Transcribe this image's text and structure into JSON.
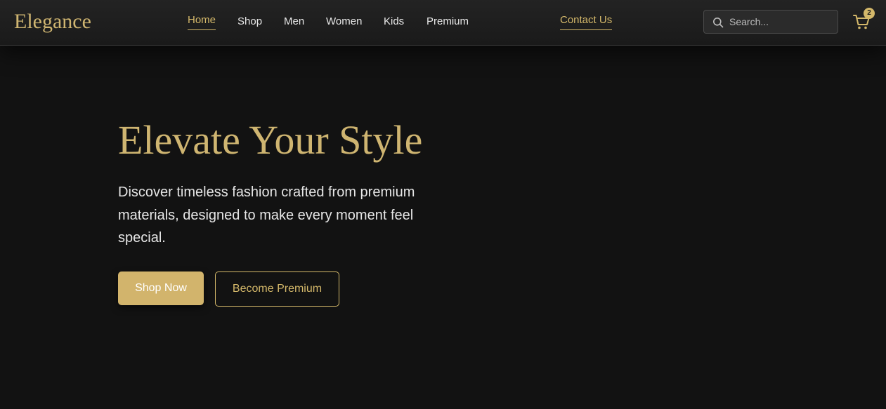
{
  "brand": {
    "logo_text": "Elegance",
    "accent_color": "#d4b86a",
    "background_color": "#121212"
  },
  "nav": {
    "items": [
      {
        "label": "Home",
        "active": true
      },
      {
        "label": "Shop",
        "active": false
      },
      {
        "label": "Men",
        "active": false
      },
      {
        "label": "Women",
        "active": false
      },
      {
        "label": "Kids",
        "active": false
      },
      {
        "label": "Premium",
        "active": false
      }
    ],
    "contact_label": "Contact Us"
  },
  "search": {
    "placeholder": "Search...",
    "value": "",
    "icon": "search-icon"
  },
  "cart": {
    "icon": "cart-icon",
    "count": "2"
  },
  "hero": {
    "title": "Elevate Your Style",
    "description": "Discover timeless fashion crafted from premium materials, designed to make every moment feel special.",
    "primary_button": "Shop Now",
    "secondary_button": "Become Premium"
  }
}
